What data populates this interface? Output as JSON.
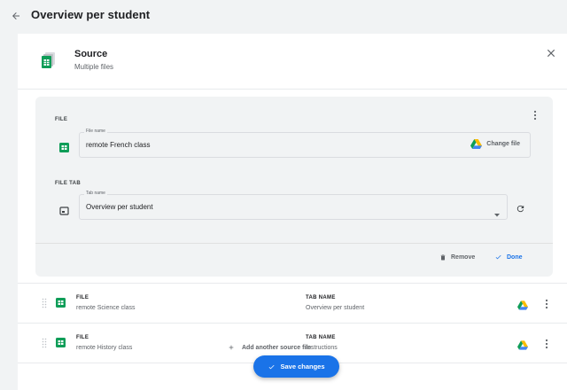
{
  "header": {
    "title": "Overview per student"
  },
  "source": {
    "title": "Source",
    "subtitle": "Multiple files"
  },
  "editor": {
    "file_section_label": "FILE",
    "file_field_legend": "File name",
    "file_name": "remote French class",
    "change_file_label": "Change file",
    "tab_section_label": "FILE TAB",
    "tab_field_legend": "Tab name",
    "tab_name": "Overview per student",
    "remove_label": "Remove",
    "done_label": "Done"
  },
  "files": [
    {
      "file_label": "FILE",
      "file_name": "remote Science class",
      "tab_label": "TAB NAME",
      "tab_name": "Overview per student"
    },
    {
      "file_label": "FILE",
      "file_name": "remote History class",
      "tab_label": "TAB NAME",
      "tab_name": "Instructions"
    }
  ],
  "footer": {
    "add_source_label": "Add another source file",
    "save_label": "Save changes"
  },
  "colors": {
    "accent": "#1a73e8",
    "sheets_green": "#0f9d58",
    "background": "#f1f3f4"
  }
}
